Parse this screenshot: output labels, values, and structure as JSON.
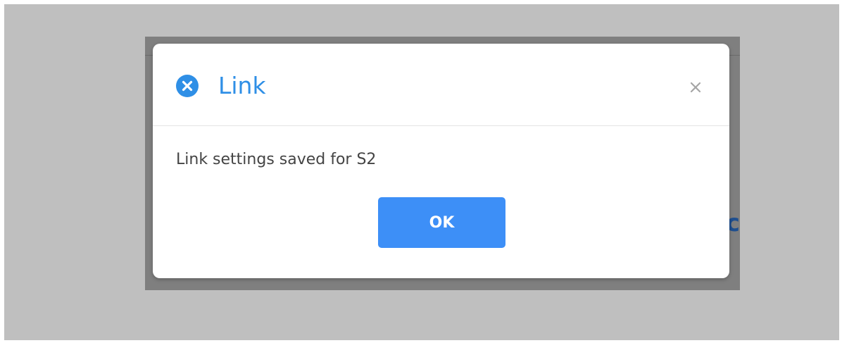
{
  "dialog": {
    "title": "Link",
    "message": "Link settings saved for S2",
    "ok_label": "OK",
    "close_glyph": "×",
    "status_icon": "error-circle-x-icon",
    "accent_color": "#2f8fe6",
    "button_color": "#3d8ff7"
  }
}
